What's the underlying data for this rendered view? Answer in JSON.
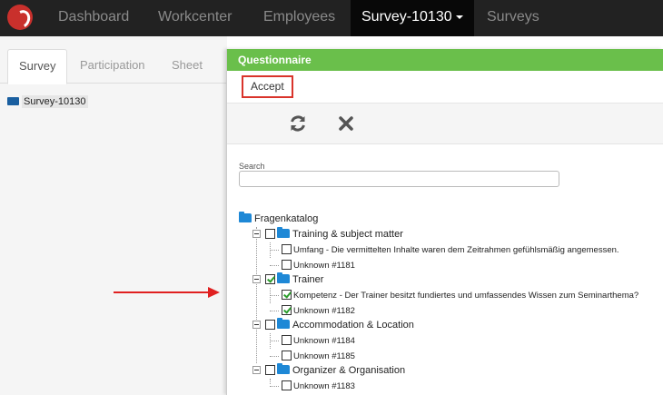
{
  "nav": {
    "items": [
      "Dashboard",
      "Workcenter",
      "Employees",
      "Survey-10130",
      "Surveys"
    ],
    "active_index": 3
  },
  "left": {
    "tabs": [
      "Survey",
      "Participation",
      "Sheet"
    ],
    "active_tab": 0,
    "tree_root": "Survey-10130"
  },
  "modal": {
    "title": "Questionnaire",
    "accept_label": "Accept",
    "refresh_icon": "refresh-icon",
    "cancel_icon": "close-icon",
    "search_label": "Search",
    "search_value": "",
    "tree": {
      "root": "Fragenkatalog",
      "groups": [
        {
          "label": "Training & subject matter",
          "checked": false,
          "items": [
            {
              "label": "Umfang - Die vermittelten Inhalte waren dem Zeitrahmen gefühlsmäßig angemessen.",
              "checked": false
            },
            {
              "label": "Unknown #1181",
              "checked": false
            }
          ]
        },
        {
          "label": "Trainer",
          "checked": true,
          "items": [
            {
              "label": "Kompetenz - Der Trainer besitzt fundiertes und umfassendes Wissen zum Seminarthema?",
              "checked": true
            },
            {
              "label": "Unknown #1182",
              "checked": true
            }
          ]
        },
        {
          "label": "Accommodation & Location",
          "checked": false,
          "items": [
            {
              "label": "Unknown #1184",
              "checked": false
            },
            {
              "label": "Unknown #1185",
              "checked": false
            }
          ]
        },
        {
          "label": "Organizer & Organisation",
          "checked": false,
          "items": [
            {
              "label": "Unknown #1183",
              "checked": false
            }
          ]
        }
      ]
    }
  },
  "colors": {
    "navbar_bg": "#222222",
    "modal_header": "#6abf4b",
    "accept_border": "#d9342b",
    "arrow": "#e02020",
    "folder": "#1e88d6"
  }
}
